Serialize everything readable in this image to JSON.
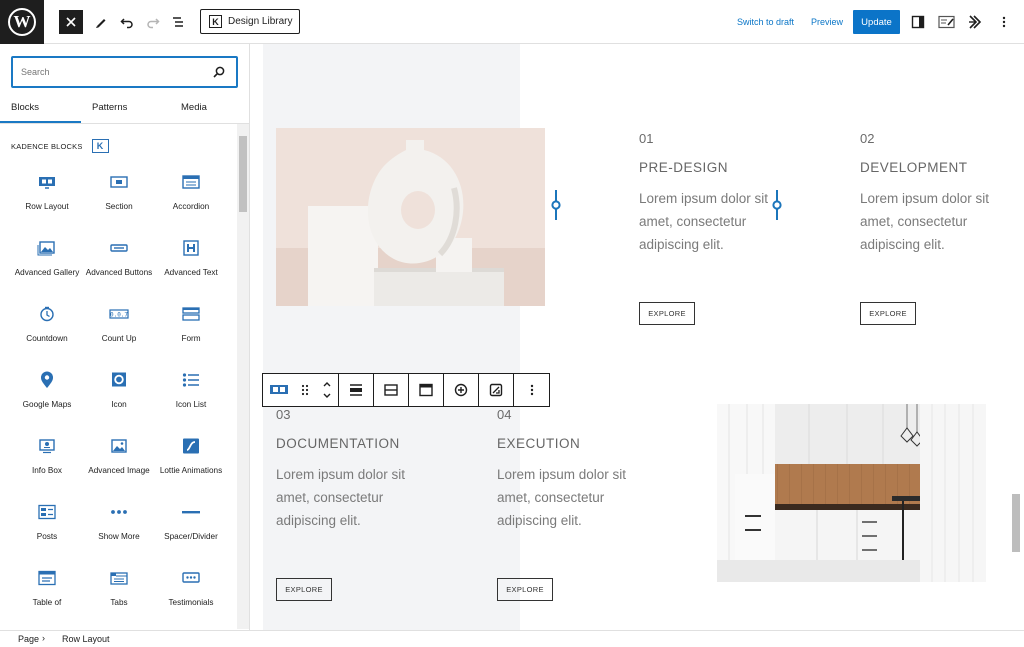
{
  "topbar": {
    "logo_glyph": "W",
    "design_library_label": "Design Library",
    "switch_to_draft": "Switch to draft",
    "preview": "Preview",
    "update": "Update"
  },
  "sidebar": {
    "search_placeholder": "Search",
    "tabs": [
      "Blocks",
      "Patterns",
      "Media"
    ],
    "active_tab": "Blocks",
    "category": "KADENCE BLOCKS",
    "blocks": [
      {
        "label": "Row Layout",
        "icon": "row-layout-icon"
      },
      {
        "label": "Section",
        "icon": "section-icon"
      },
      {
        "label": "Accordion",
        "icon": "accordion-icon"
      },
      {
        "label": "Advanced Gallery",
        "icon": "gallery-icon"
      },
      {
        "label": "Advanced Buttons",
        "icon": "buttons-icon"
      },
      {
        "label": "Advanced Text",
        "icon": "heading-icon"
      },
      {
        "label": "Countdown",
        "icon": "countdown-icon"
      },
      {
        "label": "Count Up",
        "icon": "count-up-icon"
      },
      {
        "label": "Form",
        "icon": "form-icon"
      },
      {
        "label": "Google Maps",
        "icon": "map-pin-icon"
      },
      {
        "label": "Icon",
        "icon": "icon-icon"
      },
      {
        "label": "Icon List",
        "icon": "icon-list-icon"
      },
      {
        "label": "Info Box",
        "icon": "info-box-icon"
      },
      {
        "label": "Advanced Image",
        "icon": "image-icon"
      },
      {
        "label": "Lottie Animations",
        "icon": "lottie-icon"
      },
      {
        "label": "Posts",
        "icon": "posts-icon"
      },
      {
        "label": "Show More",
        "icon": "ellipsis-icon"
      },
      {
        "label": "Spacer/Divider",
        "icon": "divider-icon"
      },
      {
        "label": "Table of",
        "icon": "table-of-contents-icon"
      },
      {
        "label": "Tabs",
        "icon": "tabs-icon"
      },
      {
        "label": "Testimonials",
        "icon": "testimonials-icon"
      }
    ]
  },
  "canvas": {
    "steps": [
      {
        "num": "01",
        "title": "PRE-DESIGN",
        "desc": "Lorem ipsum dolor sit amet, consectetur adipiscing elit.",
        "button": "EXPLORE"
      },
      {
        "num": "02",
        "title": "DEVELOPMENT",
        "desc": "Lorem ipsum dolor sit amet, consectetur adipiscing elit.",
        "button": "EXPLORE"
      },
      {
        "num": "03",
        "title": "DOCUMENTATION",
        "desc": "Lorem ipsum dolor sit amet, consectetur adipiscing elit.",
        "button": "EXPLORE"
      },
      {
        "num": "04",
        "title": "EXECUTION",
        "desc": "Lorem ipsum dolor sit amet, consectetur adipiscing elit.",
        "button": "EXPLORE"
      }
    ]
  },
  "footer": {
    "breadcrumb": [
      "Page",
      "Row Layout"
    ]
  },
  "colors": {
    "accent": "#0b74c8",
    "kadence_blue": "#2a6fb3",
    "connector": "#1b75bb"
  }
}
